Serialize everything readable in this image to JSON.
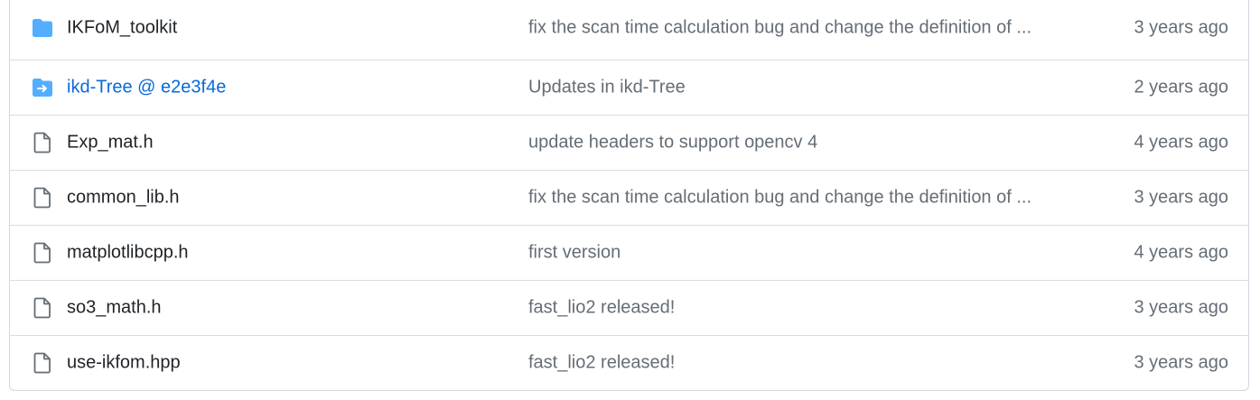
{
  "files": [
    {
      "icon": "folder-icon",
      "name": "IKFoM_toolkit",
      "message": "fix the scan time calculation bug and change the definition of ...",
      "age": "3 years ago"
    },
    {
      "icon": "submodule-folder-icon",
      "name": "ikd-Tree @ e2e3f4e",
      "message": "Updates in ikd-Tree",
      "age": "2 years ago"
    },
    {
      "icon": "file-icon",
      "name": "Exp_mat.h",
      "message": "update headers to support opencv 4",
      "age": "4 years ago"
    },
    {
      "icon": "file-icon",
      "name": "common_lib.h",
      "message": "fix the scan time calculation bug and change the definition of ...",
      "age": "3 years ago"
    },
    {
      "icon": "file-icon",
      "name": "matplotlibcpp.h",
      "message": "first version",
      "age": "4 years ago"
    },
    {
      "icon": "file-icon",
      "name": "so3_math.h",
      "message": "fast_lio2 released!",
      "age": "3 years ago"
    },
    {
      "icon": "file-icon",
      "name": "use-ikfom.hpp",
      "message": "fast_lio2 released!",
      "age": "3 years ago"
    }
  ],
  "colors": {
    "folder": "#54aeff",
    "link": "#0969da",
    "file_icon": "#656d76",
    "border": "#d0d7de"
  }
}
